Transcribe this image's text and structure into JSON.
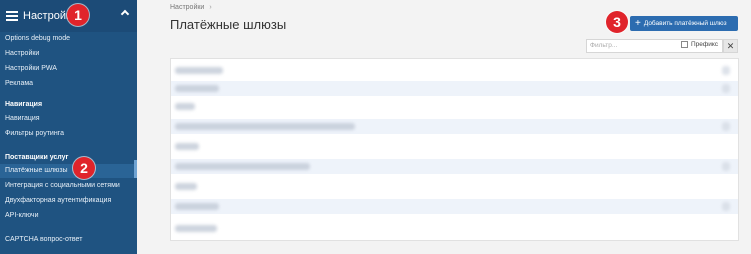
{
  "sidebar": {
    "title": "Настройки",
    "items": [
      {
        "label": "Options debug mode",
        "type": "item"
      },
      {
        "label": "Настройки",
        "type": "item"
      },
      {
        "label": "Настройки PWA",
        "type": "item"
      },
      {
        "label": "Реклама",
        "type": "item"
      },
      {
        "label": "Навигация",
        "type": "group"
      },
      {
        "label": "Навигация",
        "type": "item"
      },
      {
        "label": "Фильтры роутинга",
        "type": "item"
      },
      {
        "label": "Поставщики услуг",
        "type": "group"
      },
      {
        "label": "Платёжные шлюзы",
        "type": "item",
        "active": true
      },
      {
        "label": "Интеграция с социальными сетями",
        "type": "item"
      },
      {
        "label": "Двухфакторная аутентификация",
        "type": "item"
      },
      {
        "label": "API-ключи",
        "type": "item"
      },
      {
        "label": "CAPTCHA вопрос-ответ",
        "type": "item"
      }
    ]
  },
  "badges": [
    "1",
    "2",
    "3"
  ],
  "breadcrumb": {
    "item": "Настройки",
    "separator": "›"
  },
  "page": {
    "title": "Платёжные шлюзы"
  },
  "toolbar": {
    "add_label": "Добавить платёжный шлюз",
    "add_icon": "+"
  },
  "filter": {
    "placeholder": "Фильтр...",
    "prefix_label": "Префикс",
    "clear_label": "✕"
  },
  "colors": {
    "sidebar": "#1f5381",
    "accent": "#2c6cb0",
    "badge": "#e0242b"
  }
}
